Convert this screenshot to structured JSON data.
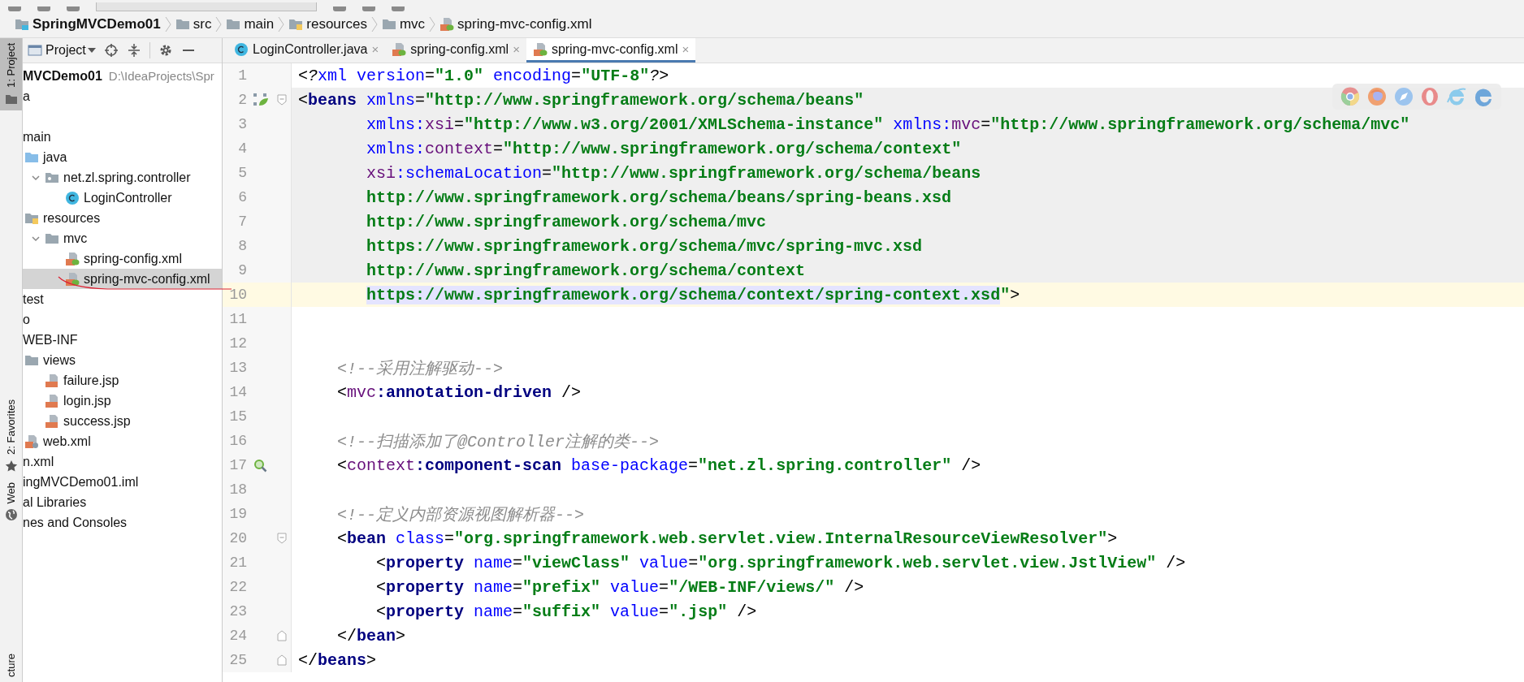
{
  "breadcrumbs": [
    {
      "label": "SpringMVCDemo01",
      "kind": "module"
    },
    {
      "label": "src",
      "kind": "folder"
    },
    {
      "label": "main",
      "kind": "folder"
    },
    {
      "label": "resources",
      "kind": "resources"
    },
    {
      "label": "mvc",
      "kind": "folder"
    },
    {
      "label": "spring-mvc-config.xml",
      "kind": "spring"
    }
  ],
  "tool_strip": [
    {
      "label": "1: Project",
      "selected": true,
      "kind": "folder"
    },
    {
      "label": "2: Favorites",
      "selected": false,
      "kind": "star"
    },
    {
      "label": "Web",
      "selected": false,
      "kind": "globe"
    },
    {
      "label": "cture",
      "selected": false,
      "kind": "none"
    }
  ],
  "project_panel": {
    "title": "Project",
    "tree": [
      {
        "label": "MVCDemo01",
        "path": "D:\\IdeaProjects\\Spr",
        "kind": "root",
        "selected": false
      },
      {
        "label": "a",
        "kind": "cut",
        "selected": false
      },
      {
        "label": "main",
        "kind": "cut",
        "selected": false,
        "children": [
          {
            "label": "java",
            "kind": "source",
            "selected": false,
            "children": [
              {
                "label": "net.zl.spring.controller",
                "kind": "package",
                "expanded": true,
                "selected": false,
                "children": [
                  {
                    "label": "LoginController",
                    "kind": "class",
                    "selected": false
                  }
                ]
              }
            ]
          },
          {
            "label": "resources",
            "kind": "resources",
            "selected": false,
            "children": [
              {
                "label": "mvc",
                "kind": "folder",
                "expanded": true,
                "selected": false,
                "children": [
                  {
                    "label": "spring-config.xml",
                    "kind": "spring",
                    "selected": false
                  },
                  {
                    "label": "spring-mvc-config.xml",
                    "kind": "spring",
                    "selected": true
                  }
                ]
              }
            ]
          }
        ]
      },
      {
        "label": "test",
        "kind": "cut",
        "selected": false
      },
      {
        "label": "o",
        "kind": "cut",
        "selected": false
      },
      {
        "label": "WEB-INF",
        "kind": "cut",
        "selected": false,
        "children": [
          {
            "label": "views",
            "kind": "folder",
            "selected": false,
            "children": [
              {
                "label": "failure.jsp",
                "kind": "jsp",
                "selected": false
              },
              {
                "label": "login.jsp",
                "kind": "jsp",
                "selected": false
              },
              {
                "label": "success.jsp",
                "kind": "jsp",
                "selected": false
              }
            ]
          },
          {
            "label": "web.xml",
            "kind": "webxml",
            "selected": false
          }
        ]
      },
      {
        "label": "n.xml",
        "kind": "cut",
        "selected": false
      },
      {
        "label": "ingMVCDemo01.iml",
        "kind": "cut",
        "selected": false
      },
      {
        "label": "al Libraries",
        "kind": "cut",
        "selected": false
      },
      {
        "label": "nes and Consoles",
        "kind": "cut",
        "selected": false
      }
    ]
  },
  "tabs": [
    {
      "label": "LoginController.java",
      "kind": "class",
      "selected": false,
      "close": "×"
    },
    {
      "label": "spring-config.xml",
      "kind": "spring",
      "selected": false,
      "close": "×"
    },
    {
      "label": "spring-mvc-config.xml",
      "kind": "spring",
      "selected": true,
      "close": "×"
    }
  ],
  "editor": {
    "lines": [
      {
        "number": "1",
        "highlighted": false,
        "current": false,
        "continuation": false,
        "tokens": [
          {
            "kind": "pi",
            "text": "<?"
          },
          {
            "kind": "attr",
            "text": "xml version"
          },
          {
            "kind": "punct",
            "text": "="
          },
          {
            "kind": "value",
            "text": "\"1.0\""
          },
          {
            "kind": "attr",
            "text": " encoding"
          },
          {
            "kind": "punct",
            "text": "="
          },
          {
            "kind": "value",
            "text": "\"UTF-8\""
          },
          {
            "kind": "pi",
            "text": "?>"
          }
        ]
      },
      {
        "number": "2",
        "highlighted": true,
        "current": false,
        "continuation": false,
        "gutter_icon": {
          "kind": "bean"
        },
        "fold_marker": {
          "kind": "start"
        },
        "tokens": [
          {
            "kind": "punct",
            "text": "<"
          },
          {
            "kind": "tag",
            "text": "beans"
          },
          {
            "kind": "attr",
            "text": " xmlns"
          },
          {
            "kind": "punct",
            "text": "="
          },
          {
            "kind": "value",
            "text": "\"http://www.springframework.org/schema/beans\""
          }
        ]
      },
      {
        "number": "3",
        "highlighted": true,
        "current": false,
        "continuation": true,
        "tokens": [
          {
            "kind": "attr",
            "text": "xmlns:"
          },
          {
            "kind": "ns",
            "text": "xsi"
          },
          {
            "kind": "punct",
            "text": "="
          },
          {
            "kind": "value",
            "text": "\"http://www.w3.org/2001/XMLSchema-instance\""
          },
          {
            "kind": "attr",
            "text": " xmlns:"
          },
          {
            "kind": "ns",
            "text": "mvc"
          },
          {
            "kind": "punct",
            "text": "="
          },
          {
            "kind": "value",
            "text": "\"http://www.springframework.org/schema/mvc\""
          }
        ]
      },
      {
        "number": "4",
        "highlighted": true,
        "current": false,
        "continuation": true,
        "tokens": [
          {
            "kind": "attr",
            "text": "xmlns:"
          },
          {
            "kind": "ns",
            "text": "context"
          },
          {
            "kind": "punct",
            "text": "="
          },
          {
            "kind": "value",
            "text": "\"http://www.springframework.org/schema/context\""
          }
        ]
      },
      {
        "number": "5",
        "highlighted": true,
        "current": false,
        "continuation": true,
        "tokens": [
          {
            "kind": "ns",
            "text": "xsi"
          },
          {
            "kind": "attr",
            "text": ":schemaLocation"
          },
          {
            "kind": "punct",
            "text": "="
          },
          {
            "kind": "value",
            "text": "\"http://www.springframework.org/schema/beans"
          }
        ]
      },
      {
        "number": "6",
        "highlighted": true,
        "current": false,
        "continuation": true,
        "tokens": [
          {
            "kind": "value",
            "text": "http://www.springframework.org/schema/beans/spring-beans.xsd"
          }
        ]
      },
      {
        "number": "7",
        "highlighted": true,
        "current": false,
        "continuation": true,
        "tokens": [
          {
            "kind": "value",
            "text": "http://www.springframework.org/schema/mvc"
          }
        ]
      },
      {
        "number": "8",
        "highlighted": true,
        "current": false,
        "continuation": true,
        "tokens": [
          {
            "kind": "value",
            "text": "https://www.springframework.org/schema/mvc/spring-mvc.xsd"
          }
        ]
      },
      {
        "number": "9",
        "highlighted": true,
        "current": false,
        "continuation": true,
        "tokens": [
          {
            "kind": "value",
            "text": "http://www.springframework.org/schema/context"
          }
        ]
      },
      {
        "number": "10",
        "highlighted": false,
        "current": true,
        "continuation": true,
        "tokens": [
          {
            "kind": "value-marked",
            "text": "https://www.springframework.org/schema/context/spring-context.xsd"
          },
          {
            "kind": "value",
            "text": "\""
          },
          {
            "kind": "punct",
            "text": ">"
          }
        ]
      },
      {
        "number": "11",
        "highlighted": false,
        "current": false
      },
      {
        "number": "12",
        "highlighted": false,
        "current": false
      },
      {
        "number": "13",
        "highlighted": false,
        "current": false,
        "continuation": false,
        "tokens": [
          {
            "kind": "comment",
            "text": "    <!--采用注解驱动-->"
          }
        ]
      },
      {
        "number": "14",
        "highlighted": false,
        "current": false,
        "continuation": false,
        "tokens": [
          {
            "kind": "punct",
            "text": "    <"
          },
          {
            "kind": "ns",
            "text": "mvc"
          },
          {
            "kind": "tag",
            "text": ":annotation-driven"
          },
          {
            "kind": "punct",
            "text": " />"
          }
        ]
      },
      {
        "number": "15",
        "highlighted": false,
        "current": false
      },
      {
        "number": "16",
        "highlighted": false,
        "current": false,
        "continuation": false,
        "tokens": [
          {
            "kind": "comment",
            "text": "    <!--扫描添加了@Controller注解的类-->"
          }
        ]
      },
      {
        "number": "17",
        "highlighted": false,
        "current": false,
        "continuation": false,
        "gutter_icon": {
          "kind": "scan"
        },
        "tokens": [
          {
            "kind": "punct",
            "text": "    <"
          },
          {
            "kind": "ns",
            "text": "context"
          },
          {
            "kind": "tag",
            "text": ":component-scan"
          },
          {
            "kind": "attr",
            "text": " base-package"
          },
          {
            "kind": "punct",
            "text": "="
          },
          {
            "kind": "value",
            "text": "\"net.zl.spring.controller\""
          },
          {
            "kind": "punct",
            "text": " />"
          }
        ]
      },
      {
        "number": "18",
        "highlighted": false,
        "current": false
      },
      {
        "number": "19",
        "highlighted": false,
        "current": false,
        "continuation": false,
        "tokens": [
          {
            "kind": "comment",
            "text": "    <!--定义内部资源视图解析器-->"
          }
        ]
      },
      {
        "number": "20",
        "highlighted": false,
        "current": false,
        "continuation": false,
        "fold_marker": {
          "kind": "start"
        },
        "tokens": [
          {
            "kind": "punct",
            "text": "    <"
          },
          {
            "kind": "tag",
            "text": "bean"
          },
          {
            "kind": "attr",
            "text": " class"
          },
          {
            "kind": "punct",
            "text": "="
          },
          {
            "kind": "value",
            "text": "\"org.springframework.web.servlet.view.InternalResourceViewResolver\""
          },
          {
            "kind": "punct",
            "text": ">"
          }
        ]
      },
      {
        "number": "21",
        "highlighted": false,
        "current": false,
        "continuation": false,
        "tokens": [
          {
            "kind": "punct",
            "text": "        <"
          },
          {
            "kind": "tag",
            "text": "property"
          },
          {
            "kind": "attr",
            "text": " name"
          },
          {
            "kind": "punct",
            "text": "="
          },
          {
            "kind": "value",
            "text": "\"viewClass\""
          },
          {
            "kind": "attr",
            "text": " value"
          },
          {
            "kind": "punct",
            "text": "="
          },
          {
            "kind": "value",
            "text": "\"org.springframework.web.servlet.view.JstlView\""
          },
          {
            "kind": "punct",
            "text": " />"
          }
        ]
      },
      {
        "number": "22",
        "highlighted": false,
        "current": false,
        "continuation": false,
        "tokens": [
          {
            "kind": "punct",
            "text": "        <"
          },
          {
            "kind": "tag",
            "text": "property"
          },
          {
            "kind": "attr",
            "text": " name"
          },
          {
            "kind": "punct",
            "text": "="
          },
          {
            "kind": "value",
            "text": "\"prefix\""
          },
          {
            "kind": "attr",
            "text": " value"
          },
          {
            "kind": "punct",
            "text": "="
          },
          {
            "kind": "value",
            "text": "\"/WEB-INF/views/\""
          },
          {
            "kind": "punct",
            "text": " />"
          }
        ]
      },
      {
        "number": "23",
        "highlighted": false,
        "current": false,
        "continuation": false,
        "tokens": [
          {
            "kind": "punct",
            "text": "        <"
          },
          {
            "kind": "tag",
            "text": "property"
          },
          {
            "kind": "attr",
            "text": " name"
          },
          {
            "kind": "punct",
            "text": "="
          },
          {
            "kind": "value",
            "text": "\"suffix\""
          },
          {
            "kind": "attr",
            "text": " value"
          },
          {
            "kind": "punct",
            "text": "="
          },
          {
            "kind": "value",
            "text": "\".jsp\""
          },
          {
            "kind": "punct",
            "text": " />"
          }
        ]
      },
      {
        "number": "24",
        "highlighted": false,
        "current": false,
        "continuation": false,
        "fold_marker": {
          "kind": "end"
        },
        "tokens": [
          {
            "kind": "punct",
            "text": "    </"
          },
          {
            "kind": "tag",
            "text": "bean"
          },
          {
            "kind": "punct",
            "text": ">"
          }
        ]
      },
      {
        "number": "25",
        "highlighted": false,
        "current": false,
        "continuation": false,
        "fold_marker": {
          "kind": "end"
        },
        "tokens": [
          {
            "kind": "punct",
            "text": "</"
          },
          {
            "kind": "tag",
            "text": "beans"
          },
          {
            "kind": "punct",
            "text": ">"
          }
        ]
      }
    ]
  }
}
